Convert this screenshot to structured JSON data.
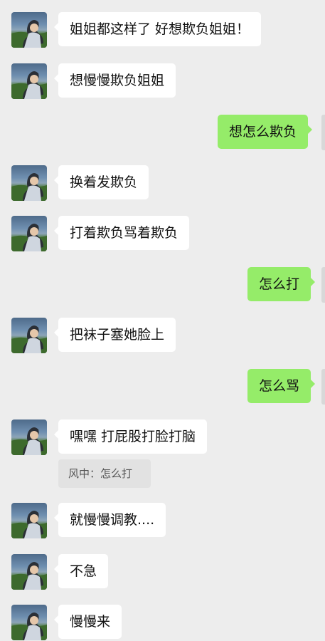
{
  "messages": [
    {
      "side": "left",
      "text": "姐姐都这样了 好想欺负姐姐！"
    },
    {
      "side": "left",
      "text": "想慢慢欺负姐姐"
    },
    {
      "side": "right",
      "text": "想怎么欺负"
    },
    {
      "side": "left",
      "text": "换着发欺负"
    },
    {
      "side": "left",
      "text": "打着欺负骂着欺负"
    },
    {
      "side": "right",
      "text": "怎么打"
    },
    {
      "side": "left",
      "text": "把袜子塞她脸上"
    },
    {
      "side": "right",
      "text": "怎么骂"
    },
    {
      "side": "left",
      "text": "嘿嘿 打屁股打脸打脑"
    },
    {
      "side": "left",
      "text": "就慢慢调教...."
    },
    {
      "side": "left",
      "text": "不急"
    },
    {
      "side": "left",
      "text": "慢慢来"
    }
  ],
  "quote": {
    "text": "风中：怎么打"
  },
  "colors": {
    "background": "#ededed",
    "left_bubble": "#ffffff",
    "right_bubble": "#95ec69"
  },
  "icons": {
    "contact_avatar": "person-photo-avatar-icon"
  }
}
